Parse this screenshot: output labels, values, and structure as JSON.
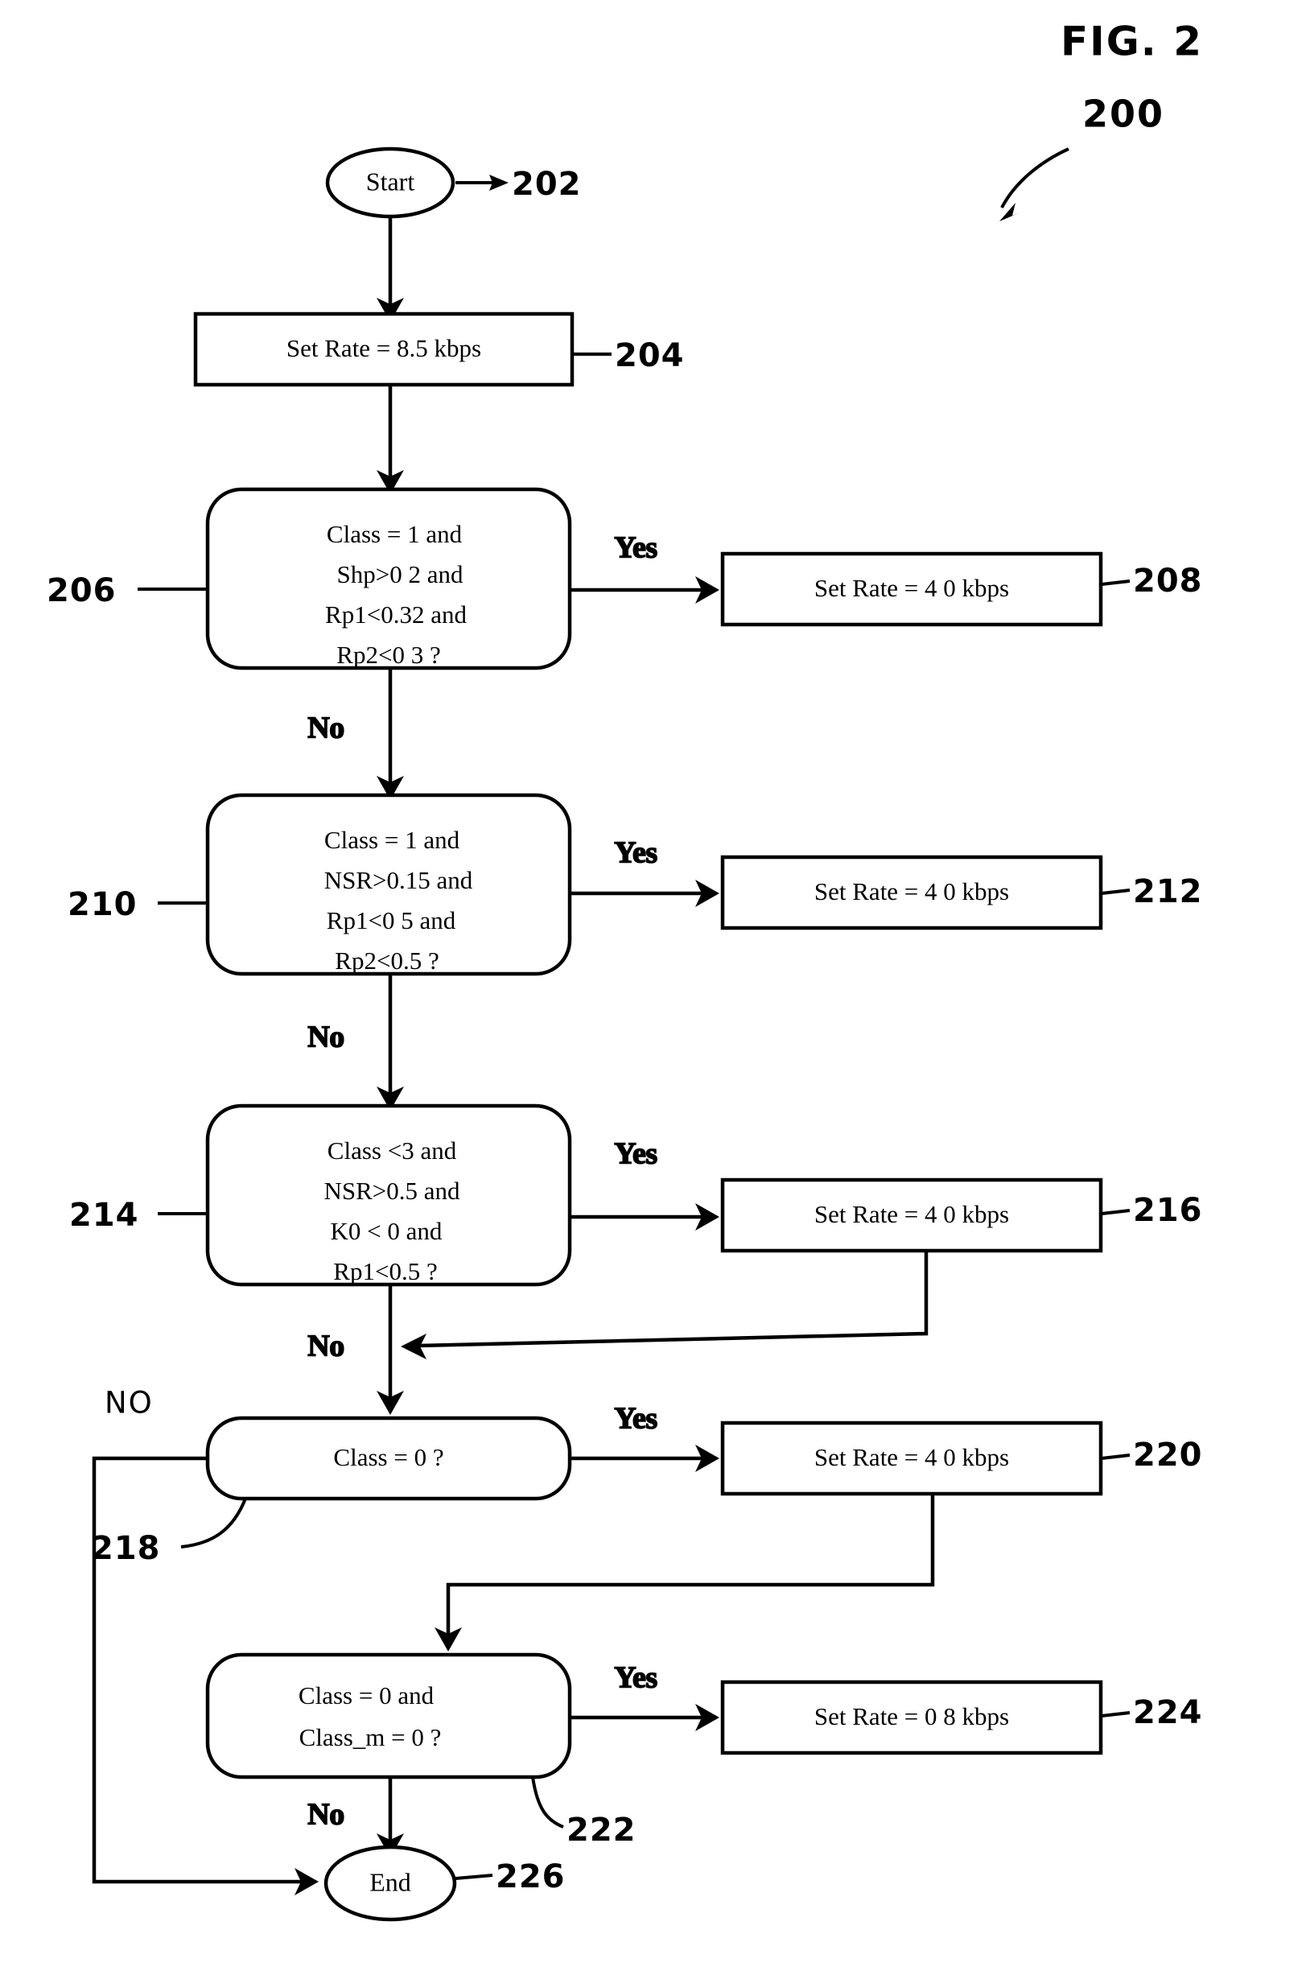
{
  "figure": {
    "title": "FIG. 2",
    "reference_numeral": "200"
  },
  "nodes": {
    "start": {
      "ref": "202",
      "label": "Start",
      "type": "terminator"
    },
    "set_rate_initial": {
      "ref": "204",
      "label": "Set   Rate = 8.5 kbps",
      "type": "process"
    },
    "decision_1": {
      "ref": "206",
      "type": "decision",
      "lines": [
        "Class = 1 and",
        "Shp>0 2  and",
        "Rp1<0.32  and",
        "Rp2<0 3  ?"
      ]
    },
    "set_rate_208": {
      "ref": "208",
      "label": "Set  Rate = 4 0 kbps",
      "type": "process"
    },
    "decision_2": {
      "ref": "210",
      "type": "decision",
      "lines": [
        "Class = 1 and",
        "NSR>0.15  and",
        "Rp1<0 5  and",
        "Rp2<0.5  ?"
      ]
    },
    "set_rate_212": {
      "ref": "212",
      "label": "Set  Rate = 4 0 kbps",
      "type": "process"
    },
    "decision_3": {
      "ref": "214",
      "type": "decision",
      "lines": [
        "Class <3 and",
        "NSR>0.5 and",
        "K0 < 0  and",
        "Rp1<0.5  ?"
      ]
    },
    "set_rate_216": {
      "ref": "216",
      "label": "Set  Rate = 4 0 kbps",
      "type": "process"
    },
    "decision_4": {
      "ref": "218",
      "type": "decision",
      "lines": [
        "Class = 0  ?"
      ]
    },
    "set_rate_220": {
      "ref": "220",
      "label": "Set  Rate = 4 0 kbps",
      "type": "process"
    },
    "decision_5": {
      "ref": "222",
      "type": "decision",
      "lines": [
        "Class = 0 and",
        "Class_m = 0 ?"
      ]
    },
    "set_rate_224": {
      "ref": "224",
      "label": "Set  Rate = 0 8 kbps",
      "type": "process"
    },
    "end": {
      "ref": "226",
      "label": "End",
      "type": "terminator"
    }
  },
  "branch_labels": {
    "yes_1": "Yes",
    "no_1": "No",
    "yes_2": "Yes",
    "no_2": "No",
    "yes_3": "Yes",
    "no_3": "No",
    "yes_4": "Yes",
    "no_4": "NO",
    "yes_5": "Yes",
    "no_5": "No"
  },
  "colors": {
    "ink": "#000000",
    "paper": "#ffffff"
  }
}
